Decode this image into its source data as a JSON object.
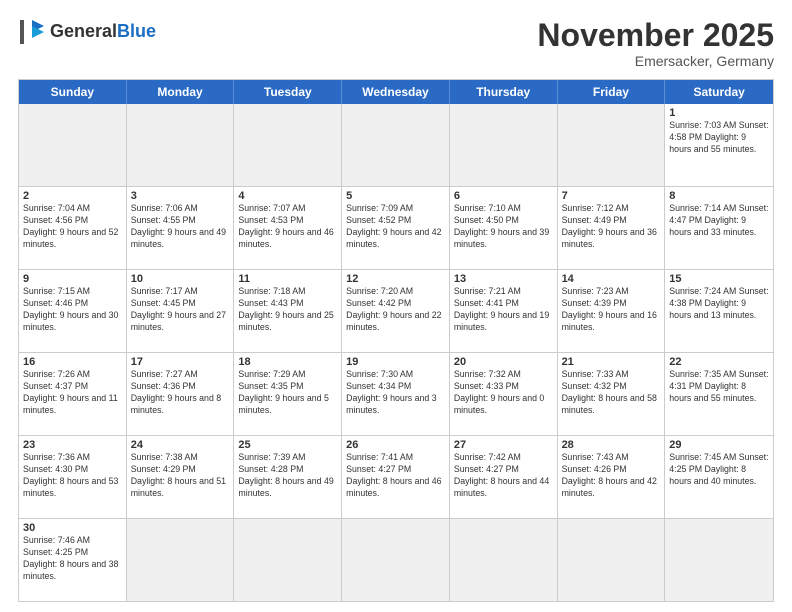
{
  "header": {
    "logo_general": "General",
    "logo_blue": "Blue",
    "month_year": "November 2025",
    "location": "Emersacker, Germany"
  },
  "weekdays": [
    "Sunday",
    "Monday",
    "Tuesday",
    "Wednesday",
    "Thursday",
    "Friday",
    "Saturday"
  ],
  "weeks": [
    [
      {
        "day": "",
        "info": "",
        "shaded": true
      },
      {
        "day": "",
        "info": "",
        "shaded": true
      },
      {
        "day": "",
        "info": "",
        "shaded": true
      },
      {
        "day": "",
        "info": "",
        "shaded": true
      },
      {
        "day": "",
        "info": "",
        "shaded": true
      },
      {
        "day": "",
        "info": "",
        "shaded": true
      },
      {
        "day": "1",
        "info": "Sunrise: 7:03 AM\nSunset: 4:58 PM\nDaylight: 9 hours and 55 minutes."
      }
    ],
    [
      {
        "day": "2",
        "info": "Sunrise: 7:04 AM\nSunset: 4:56 PM\nDaylight: 9 hours and 52 minutes."
      },
      {
        "day": "3",
        "info": "Sunrise: 7:06 AM\nSunset: 4:55 PM\nDaylight: 9 hours and 49 minutes."
      },
      {
        "day": "4",
        "info": "Sunrise: 7:07 AM\nSunset: 4:53 PM\nDaylight: 9 hours and 46 minutes."
      },
      {
        "day": "5",
        "info": "Sunrise: 7:09 AM\nSunset: 4:52 PM\nDaylight: 9 hours and 42 minutes."
      },
      {
        "day": "6",
        "info": "Sunrise: 7:10 AM\nSunset: 4:50 PM\nDaylight: 9 hours and 39 minutes."
      },
      {
        "day": "7",
        "info": "Sunrise: 7:12 AM\nSunset: 4:49 PM\nDaylight: 9 hours and 36 minutes."
      },
      {
        "day": "8",
        "info": "Sunrise: 7:14 AM\nSunset: 4:47 PM\nDaylight: 9 hours and 33 minutes."
      }
    ],
    [
      {
        "day": "9",
        "info": "Sunrise: 7:15 AM\nSunset: 4:46 PM\nDaylight: 9 hours and 30 minutes."
      },
      {
        "day": "10",
        "info": "Sunrise: 7:17 AM\nSunset: 4:45 PM\nDaylight: 9 hours and 27 minutes."
      },
      {
        "day": "11",
        "info": "Sunrise: 7:18 AM\nSunset: 4:43 PM\nDaylight: 9 hours and 25 minutes."
      },
      {
        "day": "12",
        "info": "Sunrise: 7:20 AM\nSunset: 4:42 PM\nDaylight: 9 hours and 22 minutes."
      },
      {
        "day": "13",
        "info": "Sunrise: 7:21 AM\nSunset: 4:41 PM\nDaylight: 9 hours and 19 minutes."
      },
      {
        "day": "14",
        "info": "Sunrise: 7:23 AM\nSunset: 4:39 PM\nDaylight: 9 hours and 16 minutes."
      },
      {
        "day": "15",
        "info": "Sunrise: 7:24 AM\nSunset: 4:38 PM\nDaylight: 9 hours and 13 minutes."
      }
    ],
    [
      {
        "day": "16",
        "info": "Sunrise: 7:26 AM\nSunset: 4:37 PM\nDaylight: 9 hours and 11 minutes."
      },
      {
        "day": "17",
        "info": "Sunrise: 7:27 AM\nSunset: 4:36 PM\nDaylight: 9 hours and 8 minutes."
      },
      {
        "day": "18",
        "info": "Sunrise: 7:29 AM\nSunset: 4:35 PM\nDaylight: 9 hours and 5 minutes."
      },
      {
        "day": "19",
        "info": "Sunrise: 7:30 AM\nSunset: 4:34 PM\nDaylight: 9 hours and 3 minutes."
      },
      {
        "day": "20",
        "info": "Sunrise: 7:32 AM\nSunset: 4:33 PM\nDaylight: 9 hours and 0 minutes."
      },
      {
        "day": "21",
        "info": "Sunrise: 7:33 AM\nSunset: 4:32 PM\nDaylight: 8 hours and 58 minutes."
      },
      {
        "day": "22",
        "info": "Sunrise: 7:35 AM\nSunset: 4:31 PM\nDaylight: 8 hours and 55 minutes."
      }
    ],
    [
      {
        "day": "23",
        "info": "Sunrise: 7:36 AM\nSunset: 4:30 PM\nDaylight: 8 hours and 53 minutes."
      },
      {
        "day": "24",
        "info": "Sunrise: 7:38 AM\nSunset: 4:29 PM\nDaylight: 8 hours and 51 minutes."
      },
      {
        "day": "25",
        "info": "Sunrise: 7:39 AM\nSunset: 4:28 PM\nDaylight: 8 hours and 49 minutes."
      },
      {
        "day": "26",
        "info": "Sunrise: 7:41 AM\nSunset: 4:27 PM\nDaylight: 8 hours and 46 minutes."
      },
      {
        "day": "27",
        "info": "Sunrise: 7:42 AM\nSunset: 4:27 PM\nDaylight: 8 hours and 44 minutes."
      },
      {
        "day": "28",
        "info": "Sunrise: 7:43 AM\nSunset: 4:26 PM\nDaylight: 8 hours and 42 minutes."
      },
      {
        "day": "29",
        "info": "Sunrise: 7:45 AM\nSunset: 4:25 PM\nDaylight: 8 hours and 40 minutes."
      }
    ],
    [
      {
        "day": "30",
        "info": "Sunrise: 7:46 AM\nSunset: 4:25 PM\nDaylight: 8 hours and 38 minutes."
      },
      {
        "day": "",
        "info": "",
        "shaded": true
      },
      {
        "day": "",
        "info": "",
        "shaded": true
      },
      {
        "day": "",
        "info": "",
        "shaded": true
      },
      {
        "day": "",
        "info": "",
        "shaded": true
      },
      {
        "day": "",
        "info": "",
        "shaded": true
      },
      {
        "day": "",
        "info": "",
        "shaded": true
      }
    ]
  ]
}
